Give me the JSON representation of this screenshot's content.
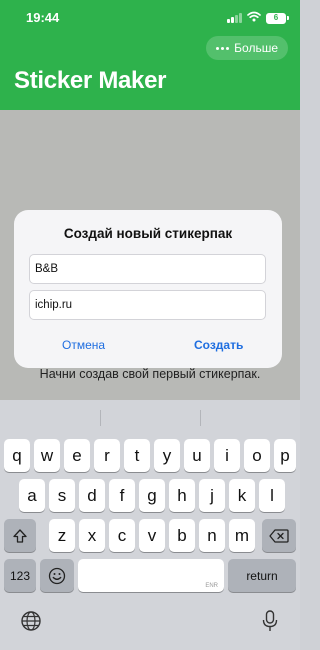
{
  "status_bar": {
    "time": "19:44",
    "battery": "6"
  },
  "header": {
    "more_label": "Больше",
    "title": "Sticker Maker"
  },
  "content": {
    "empty_text": "Начни создав свой первый стикерпак."
  },
  "dialog": {
    "title": "Создай новый стикерпак",
    "name_value": "B&B",
    "author_value": "ichip.ru",
    "cancel_label": "Отмена",
    "create_label": "Создать"
  },
  "keyboard": {
    "row1": [
      "q",
      "w",
      "e",
      "r",
      "t",
      "y",
      "u",
      "i",
      "o",
      "p"
    ],
    "row2": [
      "a",
      "s",
      "d",
      "f",
      "g",
      "h",
      "j",
      "k",
      "l"
    ],
    "row3": [
      "z",
      "x",
      "c",
      "v",
      "b",
      "n",
      "m"
    ],
    "numbers_label": "123",
    "return_label": "return",
    "space_hint": "ENR"
  },
  "colors": {
    "accent": "#2eb24c",
    "link": "#1f6ee0"
  },
  "icons": [
    "cellular-signal-icon",
    "wifi-icon",
    "battery-icon",
    "more-dots-icon",
    "shift-icon",
    "backspace-icon",
    "emoji-icon",
    "globe-icon",
    "microphone-icon"
  ]
}
